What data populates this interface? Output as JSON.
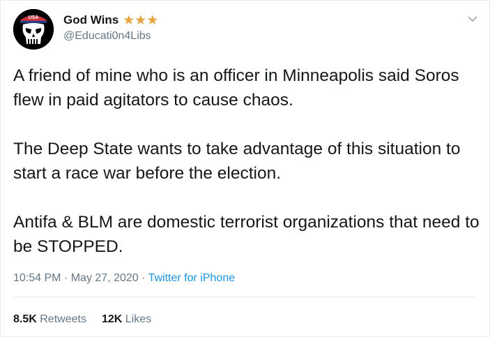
{
  "user": {
    "display_name": "God Wins",
    "badge": "★★★",
    "handle": "@Educati0n4Libs",
    "avatar_icon": "punisher-skull-icon",
    "avatar_cap_text": "USA"
  },
  "tweet": {
    "paragraphs": [
      "A friend of mine who is an officer in Minneapolis said Soros flew in paid agitators to cause chaos.",
      "The Deep State wants to take advantage of this situation to start a race war before the election.",
      "Antifa & BLM are domestic terrorist organizations that need to be STOPPED."
    ],
    "time": "10:54 PM",
    "date": "May 27, 2020",
    "separator": "·",
    "source": "Twitter for iPhone"
  },
  "stats": {
    "retweets_count": "8.5K",
    "retweets_label": "Retweets",
    "likes_count": "12K",
    "likes_label": "Likes"
  },
  "colors": {
    "secondary_text": "#657786",
    "link": "#1b95e0",
    "star": "#e8a33c"
  }
}
